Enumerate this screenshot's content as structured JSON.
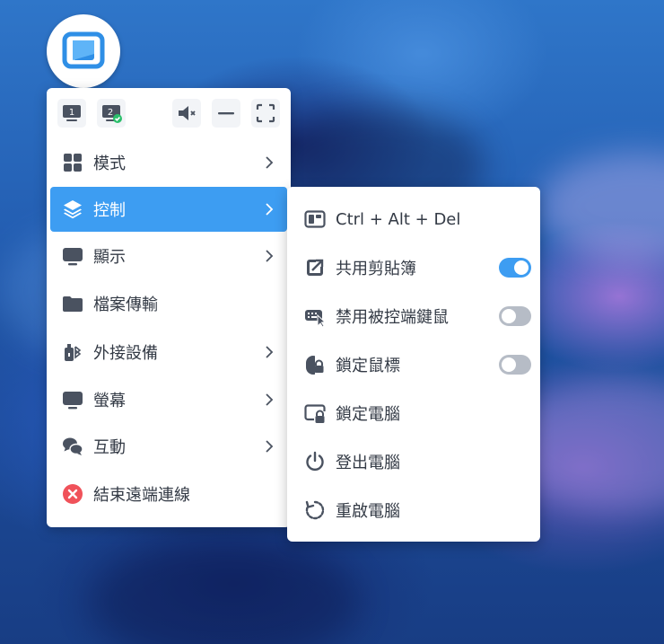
{
  "toolbar": {
    "monitor1_label": "1",
    "monitor2_label": "2"
  },
  "menu": {
    "items": [
      {
        "label": "模式",
        "icon": "grid-icon",
        "has_submenu": true
      },
      {
        "label": "控制",
        "icon": "layers-icon",
        "has_submenu": true,
        "active": true
      },
      {
        "label": "顯示",
        "icon": "monitor-icon",
        "has_submenu": true
      },
      {
        "label": "檔案傳輸",
        "icon": "folder-icon",
        "has_submenu": false
      },
      {
        "label": "外接設備",
        "icon": "usb-bluetooth-icon",
        "has_submenu": true
      },
      {
        "label": "螢幕",
        "icon": "screen-icon",
        "has_submenu": true
      },
      {
        "label": "互動",
        "icon": "chat-icon",
        "has_submenu": true
      },
      {
        "label": "結束遠端連線",
        "icon": "close-circle-icon",
        "has_submenu": false
      }
    ]
  },
  "submenu": {
    "items": [
      {
        "label": "Ctrl + Alt + Del",
        "icon": "keyboard-shortcut-icon"
      },
      {
        "label": "共用剪貼簿",
        "icon": "share-clipboard-icon",
        "toggle": true,
        "on": true
      },
      {
        "label": "禁用被控端鍵鼠",
        "icon": "keyboard-mouse-icon",
        "toggle": true,
        "on": false
      },
      {
        "label": "鎖定鼠標",
        "icon": "mouse-lock-icon",
        "toggle": true,
        "on": false
      },
      {
        "label": "鎖定電腦",
        "icon": "screen-lock-icon"
      },
      {
        "label": "登出電腦",
        "icon": "power-icon"
      },
      {
        "label": "重啟電腦",
        "icon": "restart-icon"
      }
    ]
  },
  "colors": {
    "accent": "#3d9df2",
    "icon_gray": "#4a5260",
    "danger": "#f0525a",
    "check_green": "#2bbf6b"
  }
}
